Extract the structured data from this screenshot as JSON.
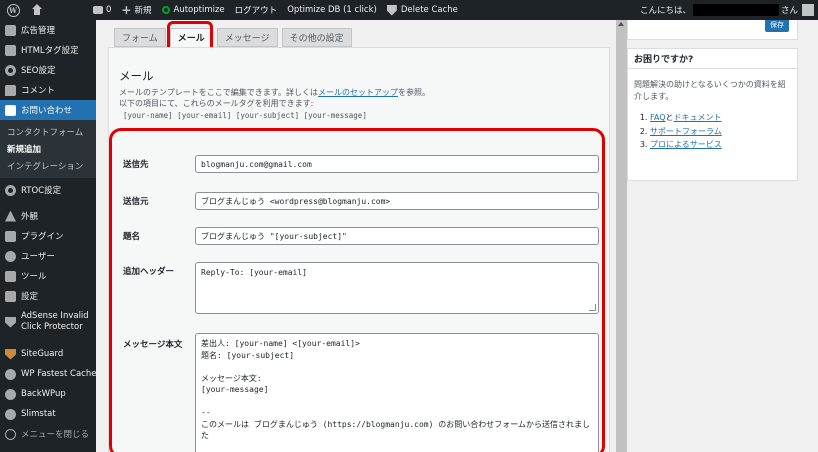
{
  "adminbar": {
    "comments_count": "0",
    "new_label": "新規",
    "autoptimize": "Autoptimize",
    "logout": "ログアウト",
    "optimize_db": "Optimize DB (1 click)",
    "delete_cache": "Delete Cache",
    "greeting": "こんにちは、",
    "greeting_suffix": "さん"
  },
  "sidebar": {
    "items": [
      {
        "label": "広告管理"
      },
      {
        "label": "HTMLタグ設定"
      },
      {
        "label": "SEO設定"
      },
      {
        "label": "コメント"
      },
      {
        "label": "お問い合わせ"
      }
    ],
    "submenu": [
      "コンタクトフォーム",
      "新規追加",
      "インテグレーション"
    ],
    "items2": [
      {
        "label": "RTOC設定"
      },
      {
        "label": "外観"
      },
      {
        "label": "プラグイン"
      },
      {
        "label": "ユーザー"
      },
      {
        "label": "ツール"
      },
      {
        "label": "設定"
      },
      {
        "label": "AdSense Invalid Click Protector"
      },
      {
        "label": "SiteGuard"
      },
      {
        "label": "WP Fastest Cache"
      },
      {
        "label": "BackWPup"
      },
      {
        "label": "Slimstat"
      },
      {
        "label": "メニューを閉じる"
      }
    ]
  },
  "tabs": [
    "フォーム",
    "メール",
    "メッセージ",
    "その他の設定"
  ],
  "mail": {
    "title": "メール",
    "desc_line1_a": "メールのテンプレートをここで編集できます。詳しくは",
    "desc_link": "メールのセットアップ",
    "desc_line1_b": "を参照。",
    "desc_line2": "以下の項目にて、これらのメールタグを利用できます:",
    "tags": "[your-name] [your-email] [your-subject] [your-message]"
  },
  "fields": {
    "to_label": "送信先",
    "to_value": "blogmanju.com@gmail.com",
    "from_label": "送信元",
    "from_value": "ブログまんじゅう <wordpress@blogmanju.com>",
    "subject_label": "題名",
    "subject_value": "ブログまんじゅう \"[your-subject]\"",
    "headers_label": "追加ヘッダー",
    "headers_value": "Reply-To: [your-email]",
    "body_label": "メッセージ本文",
    "body_value": "差出人: [your-name] <[your-email]>\n題名: [your-subject]\n\nメッセージ本文:\n[your-message]\n\n--\nこのメールは ブログまんじゅう (https://blogmanju.com) のお問い合わせフォームから送信されました"
  },
  "right": {
    "save": "保存",
    "help_title": "お困りですか?",
    "help_text": "問題解決の助けとなるいくつかの資料を紹介します。",
    "links": [
      {
        "a": "FAQ",
        "mid": "と",
        "b": "ドキュメント"
      },
      {
        "a": "サポートフォーラム"
      },
      {
        "a": "プロによるサービス"
      }
    ]
  }
}
